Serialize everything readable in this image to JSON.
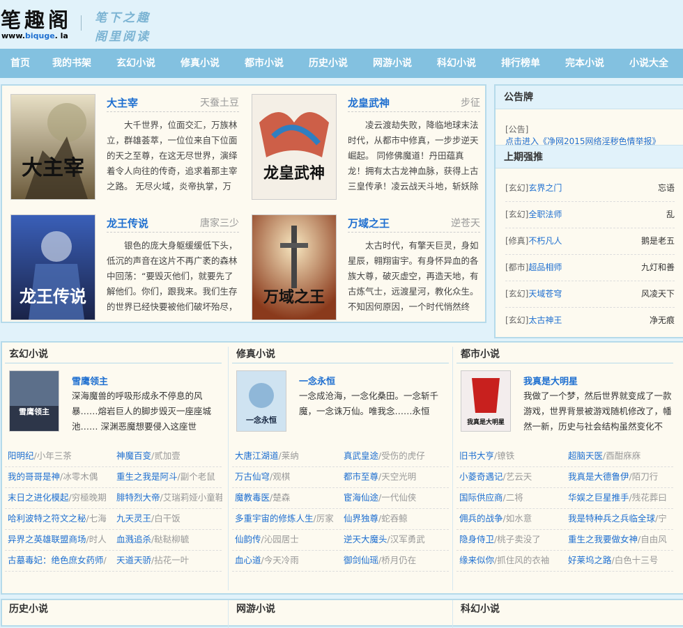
{
  "header": {
    "logo_text": "笔趣阁",
    "url_prefix": "www.",
    "url_mid": "biquge",
    "url_suffix": ". la",
    "slogan_1": "笔下之趣",
    "slogan_2": "阁里阅读"
  },
  "nav": [
    "首页",
    "我的书架",
    "玄幻小说",
    "修真小说",
    "都市小说",
    "历史小说",
    "网游小说",
    "科幻小说",
    "排行榜单",
    "完本小说",
    "小说大全"
  ],
  "featured": [
    {
      "title": "大主宰",
      "author": "天蚕土豆",
      "cover_text": "大主宰",
      "desc": "大千世界，位面交汇，万族林立，群雄荟萃，一位位来自下位面的天之至尊，在这无尽世界，演绎着令人向往的传奇，追求着那主宰之路。 无尽火域，炎帝执掌，万火焚苍穹。 武境之内，..."
    },
    {
      "title": "龙皇武神",
      "author": "步征",
      "cover_text": "龙皇武神",
      "desc": "凌云渡劫失败，降临地球末法时代，从都市中修真，一步步逆天崛起。 同修佛魔道！丹田蕴真龙！拥有太古龙神血脉，获得上古三皇传承！凌云战天斗地，斩妖除魔，一路逆天修行！ 他从..."
    },
    {
      "title": "龙王传说",
      "author": "唐家三少",
      "cover_text": "龙王传说",
      "desc": "银色的庞大身躯缓缓低下头，低沉的声音在这片不再广袤的森林中回荡：“要毁灭他们，就要先了解他们。你们，跟我来。我们生存的世界已经快要被他们破坏殆尽，为了生存，我们就要征服他们的..."
    },
    {
      "title": "万域之王",
      "author": "逆苍天",
      "cover_text": "万域之王",
      "desc": "太古时代，有擎天巨灵，身如星辰，翱翔宙宇。有身怀异血的各族大尊，破灭虚空，再造天地，有古炼气士，远渡星河，教化众生。不知因何原因，一个时代悄然终结，万域隔绝，太古巨擎一一销..."
    }
  ],
  "notice": {
    "heading": "公告牌",
    "tag": "[公告]",
    "text": "点击进入《净网2015网络淫秽色情举报》"
  },
  "recommend": {
    "heading": "上期强推",
    "items": [
      {
        "cat": "[玄幻]",
        "title": "玄界之门",
        "author": "忘语"
      },
      {
        "cat": "[玄幻]",
        "title": "全职法师",
        "author": "乱"
      },
      {
        "cat": "[修真]",
        "title": "不朽凡人",
        "author": "鹅是老五"
      },
      {
        "cat": "[都市]",
        "title": "超品相师",
        "author": "九灯和善"
      },
      {
        "cat": "[玄幻]",
        "title": "天域苍穹",
        "author": "风凌天下"
      },
      {
        "cat": "[玄幻]",
        "title": "太古神王",
        "author": "净无痕"
      }
    ]
  },
  "categories": [
    {
      "heading": "玄幻小说",
      "top": {
        "title": "雪鹰领主",
        "cover_text": "雪鹰领主",
        "desc": "深海魔兽的呼吸形成永不停息的风暴……熔岩巨人的脚步毁灭一座座城池…… 深渊恶魔想要侵入这座世界…… 而神灵降"
      },
      "list": [
        [
          {
            "t": "阳明纪",
            "a": "/小年三茶"
          },
          {
            "t": "神魔百变",
            "a": "/贰加壹"
          }
        ],
        [
          {
            "t": "我的哥哥是神",
            "a": "/冰零木偶"
          },
          {
            "t": "重生之我是阿斗",
            "a": "/副个老鼠"
          }
        ],
        [
          {
            "t": "末日之进化模起",
            "a": "/穷極晚期"
          },
          {
            "t": "腓特烈大帝",
            "a": "/艾瑞莉娅小童鞋"
          }
        ],
        [
          {
            "t": "哈利波特之符文之秘",
            "a": "/七海"
          },
          {
            "t": "九天灵王",
            "a": "/白干饭"
          }
        ],
        [
          {
            "t": "异界之英雄联盟商场",
            "a": "/时人"
          },
          {
            "t": "血溅追杀",
            "a": "/鞑鞑柳毓"
          }
        ],
        [
          {
            "t": "古墓毒妃：绝色庶女药师",
            "a": "/"
          },
          {
            "t": "天道天骄",
            "a": "/拈花一叶"
          }
        ]
      ]
    },
    {
      "heading": "修真小说",
      "top": {
        "title": "一念永恒",
        "cover_text": "一念永恒",
        "desc": "一念成沧海，一念化桑田。一念斩千魔，一念诛万仙。唯我念……永恒"
      },
      "list": [
        [
          {
            "t": "大唐江湖道",
            "a": "/莱纳"
          },
          {
            "t": "真武皇途",
            "a": "/受伤的虎仔"
          }
        ],
        [
          {
            "t": "万古仙穹",
            "a": "/观棋"
          },
          {
            "t": "都市至尊",
            "a": "/天空光明"
          }
        ],
        [
          {
            "t": "魔教毒医",
            "a": "/楚森"
          },
          {
            "t": "宦海仙途",
            "a": "/一代仙侠"
          }
        ],
        [
          {
            "t": "多重宇宙的修炼人生",
            "a": "/厉家"
          },
          {
            "t": "仙界独尊",
            "a": "/蛇吞鲸"
          }
        ],
        [
          {
            "t": "仙韵传",
            "a": "/沁园居士"
          },
          {
            "t": "逆天大魔头",
            "a": "/汉军勇武"
          }
        ],
        [
          {
            "t": "血心道",
            "a": "/今天冷雨"
          },
          {
            "t": "御剑仙瑶",
            "a": "/桥月仍在"
          }
        ]
      ]
    },
    {
      "heading": "都市小说",
      "top": {
        "title": "我真是大明星",
        "cover_text": "我真是大明星",
        "desc": "我做了一个梦，然后世界就变成了一款游戏，世界背景被游戏随机修改了，幡然一新，历史与社会结构虽然变化不大，但却"
      },
      "list": [
        [
          {
            "t": "旧书大亨",
            "a": "/镣铁"
          },
          {
            "t": "超脑天医",
            "a": "/酉酣庥庥"
          }
        ],
        [
          {
            "t": "小菱奇遇记",
            "a": "/艺云天"
          },
          {
            "t": "我真是大德鲁伊",
            "a": "/陌刀行"
          }
        ],
        [
          {
            "t": "国际供应商",
            "a": "/二将"
          },
          {
            "t": "华娱之巨星推手",
            "a": "/残花葬曰"
          }
        ],
        [
          {
            "t": "佣兵的战争",
            "a": "/如水意"
          },
          {
            "t": "我是特种兵之兵临全球",
            "a": "/宁"
          }
        ],
        [
          {
            "t": "隐身侍卫",
            "a": "/桃子卖没了"
          },
          {
            "t": "重生之我要做女神",
            "a": "/自由风"
          }
        ],
        [
          {
            "t": "缘来似你",
            "a": "/抓住风的衣袖"
          },
          {
            "t": "好莱坞之路",
            "a": "/白色十三号"
          }
        ]
      ]
    }
  ],
  "bottom_categories": [
    "历史小说",
    "网游小说",
    "科幻小说"
  ]
}
